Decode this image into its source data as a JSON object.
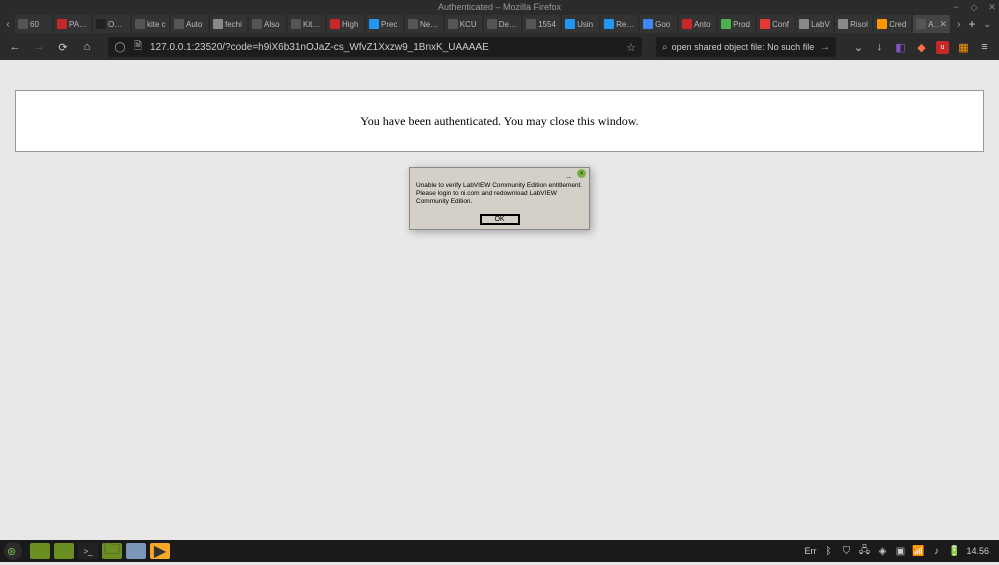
{
  "window": {
    "title": "Authenticated – Mozilla Firefox"
  },
  "tabs": [
    {
      "label": "60",
      "color": "#555"
    },
    {
      "label": "PANS",
      "color": "#c62828"
    },
    {
      "label": "OZON",
      "color": "#222"
    },
    {
      "label": "kite c",
      "color": "#555"
    },
    {
      "label": "Auto",
      "color": "#555"
    },
    {
      "label": "fechi",
      "color": "#888"
    },
    {
      "label": "Also",
      "color": "#555"
    },
    {
      "label": "Kite Ene",
      "color": "#555"
    },
    {
      "label": "High",
      "color": "#c62828"
    },
    {
      "label": "Prec",
      "color": "#2196f3"
    },
    {
      "label": "New Pos",
      "color": "#555"
    },
    {
      "label": "KCU",
      "color": "#555"
    },
    {
      "label": "Design o",
      "color": "#555"
    },
    {
      "label": "1554",
      "color": "#555"
    },
    {
      "label": "Usin",
      "color": "#2196f3"
    },
    {
      "label": "Re: V",
      "color": "#2196f3"
    },
    {
      "label": "Goo",
      "color": "#4285f4"
    },
    {
      "label": "Anto",
      "color": "#c62828"
    },
    {
      "label": "Prod",
      "color": "#4caf50"
    },
    {
      "label": "Conf",
      "color": "#e53935"
    },
    {
      "label": "LabV",
      "color": "#888"
    },
    {
      "label": "Risol",
      "color": "#888"
    },
    {
      "label": "Cred",
      "color": "#ff9800"
    },
    {
      "label": "Authe",
      "color": "#555",
      "active": true
    }
  ],
  "url": "127.0.0.1:23520/?code=h9iX6b31nOJaZ-cs_WfvZ1Xxzw9_1BnxK_UAAAAE",
  "search": "open shared object file: No such file or directory",
  "page": {
    "message": "You have been authenticated. You may close this window."
  },
  "dialog": {
    "line1": "Unable to verify LabVIEW Community Edition entitlement.",
    "line2": "Please login to ni.com and redownload LabVIEW Community Edition.",
    "ok": "OK"
  },
  "tray": {
    "err": "Err",
    "time": "14.56"
  },
  "colors": {
    "task_green": "#6b8e23",
    "task_dark": "#333",
    "task_folder": "#6b8e23",
    "task_blue": "#5e7ca0",
    "task_yellow": "#f9a825"
  }
}
